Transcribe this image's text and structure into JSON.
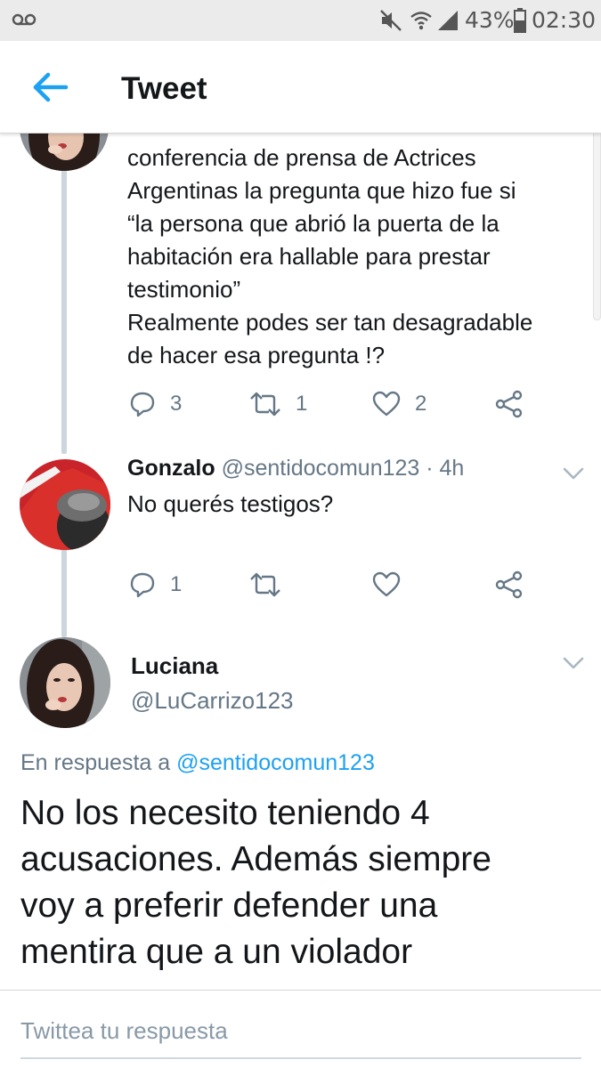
{
  "status_bar": {
    "battery": "43%",
    "time": "02:30",
    "icons": [
      "voicemail-icon",
      "mute-icon",
      "wifi-icon",
      "signal-icon",
      "battery-icon"
    ]
  },
  "appbar": {
    "title": "Tweet",
    "back_icon": "arrow-left-icon",
    "accent": "#1da1f2"
  },
  "parent_tweet": {
    "text_lines": [
      "conferencia de prensa de Actrices",
      "Argentinas la pregunta que hizo fue si",
      "“la persona que abrió la puerta de la",
      "habitación era hallable para prestar",
      "testimonio”",
      "Realmente podes ser tan desagradable",
      "de hacer esa pregunta !?"
    ],
    "actions": {
      "replies": "3",
      "retweets": "1",
      "likes": "2"
    }
  },
  "reply_tweet": {
    "name": "Gonzalo",
    "handle_time": "@sentidocomun123 · 4h",
    "text": "No querés testigos?",
    "actions": {
      "replies": "1",
      "retweets": "",
      "likes": ""
    }
  },
  "main_tweet": {
    "name": "Luciana",
    "handle": "@LuCarrizo123",
    "reply_prefix": "En respuesta a",
    "reply_mention": "@sentidocomun123",
    "text_lines": [
      "No los necesito teniendo 4",
      "acusaciones. Además siempre",
      "voy a preferir defender una",
      "mentira que a un violador"
    ]
  },
  "reply_box": {
    "placeholder": "Twittea tu respuesta"
  }
}
